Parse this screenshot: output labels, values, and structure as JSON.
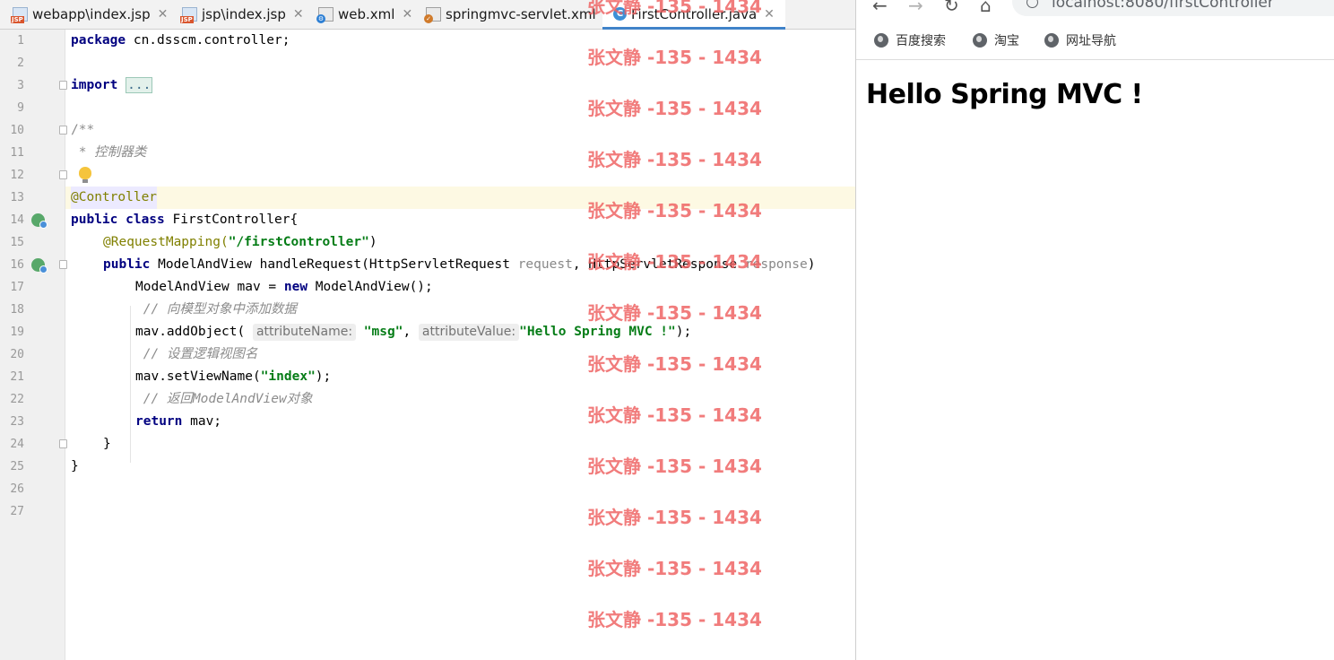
{
  "ide": {
    "tabs": [
      {
        "label": "webapp\\index.jsp",
        "icon": "jsp-file-icon",
        "active": false
      },
      {
        "label": "jsp\\index.jsp",
        "icon": "jsp-file-icon",
        "active": false
      },
      {
        "label": "web.xml",
        "icon": "xml-file-icon",
        "active": false
      },
      {
        "label": "springmvc-servlet.xml",
        "icon": "spring-xml-file-icon",
        "active": false
      },
      {
        "label": "FirstController.java",
        "icon": "java-class-icon",
        "active": true
      }
    ],
    "tab_icon_text": {
      "jsp": "JSP",
      "class": "C"
    },
    "line_numbers": [
      "1",
      "2",
      "3",
      "9",
      "10",
      "11",
      "12",
      "13",
      "14",
      "15",
      "16",
      "17",
      "18",
      "19",
      "20",
      "21",
      "22",
      "23",
      "24",
      "25",
      "26",
      "27"
    ],
    "code": {
      "l1_kw": "package",
      "l1_rest": " cn.dsscm.controller;",
      "l3_kw": "import",
      "l3_fold": "...",
      "l10": "/**",
      "l11": " * 控制器类",
      "l13": "@Controller",
      "l14_kw": "public class",
      "l14_rest": " FirstController{",
      "l15_ann": "@RequestMapping(",
      "l15_str": "\"/firstController\"",
      "l15_end": ")",
      "l16_kw": "public",
      "l16_a": " ModelAndView handleRequest(HttpServletRequest ",
      "l16_p1": "request",
      "l16_b": ", HttpServletResponse ",
      "l16_p2": "response",
      "l16_c": ")",
      "l17_a": "ModelAndView mav = ",
      "l17_kw": "new",
      "l17_b": " ModelAndView();",
      "l18": " // 向模型对象中添加数据",
      "l19_a": "mav.addObject(",
      "l19_hint1": "attributeName:",
      "l19_s1": "\"msg\"",
      "l19_comma": ",",
      "l19_hint2": "attributeValue:",
      "l19_s2": "\"Hello Spring MVC !\"",
      "l19_end": ");",
      "l20": " // 设置逻辑视图名",
      "l21_a": "mav.setViewName(",
      "l21_s": "\"index\"",
      "l21_end": ");",
      "l22": " // 返回ModelAndView对象",
      "l23_kw": "return",
      "l23_rest": " mav;",
      "l24": "}",
      "l25": "}"
    },
    "watermark": "张文静 -135 - 1434"
  },
  "browser": {
    "nav": {
      "back": "←",
      "forward": "→",
      "reload": "↻",
      "home": "⌂"
    },
    "address": "localhost:8080/firstController",
    "bookmarks": [
      "百度搜索",
      "淘宝",
      "网址导航"
    ],
    "page_heading": "Hello Spring MVC !"
  }
}
